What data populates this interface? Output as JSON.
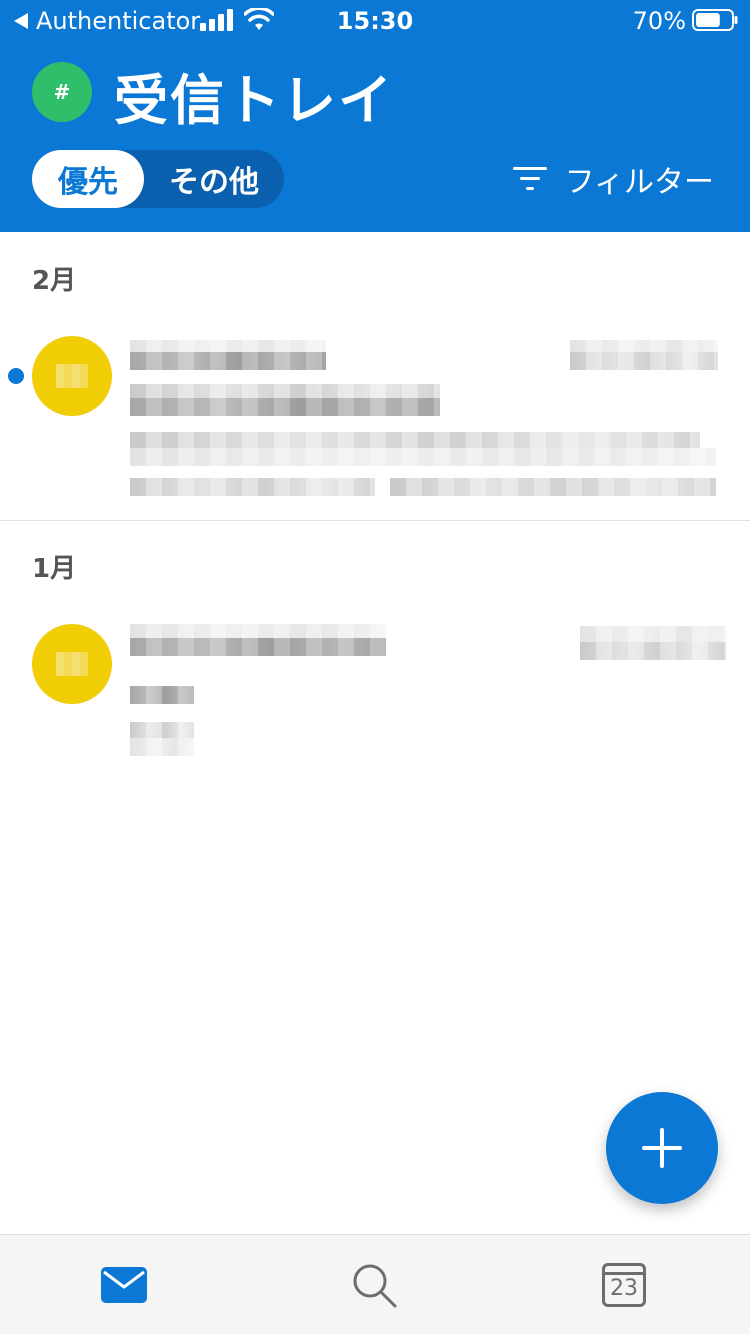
{
  "status_bar": {
    "back_app": "Authenticator",
    "time": "15:30",
    "battery_percent": "70%",
    "battery_level": 0.7
  },
  "header": {
    "avatar_symbol": "#",
    "title": "受信トレイ",
    "segmented": {
      "active_label": "優先",
      "inactive_label": "その他"
    },
    "filter_label": "フィルター"
  },
  "sections": [
    {
      "label": "2月"
    },
    {
      "label": "1月"
    }
  ],
  "icons": {
    "mail_tab": "envelope-icon",
    "search_tab": "search-icon",
    "calendar_tab": "calendar-icon",
    "fab": "plus-icon"
  },
  "calendar_tab": {
    "day": "23"
  },
  "colors": {
    "brand_blue": "#0a78d4",
    "avatar_green": "#2fbf6b",
    "avatar_yellow": "#f0cd05"
  }
}
